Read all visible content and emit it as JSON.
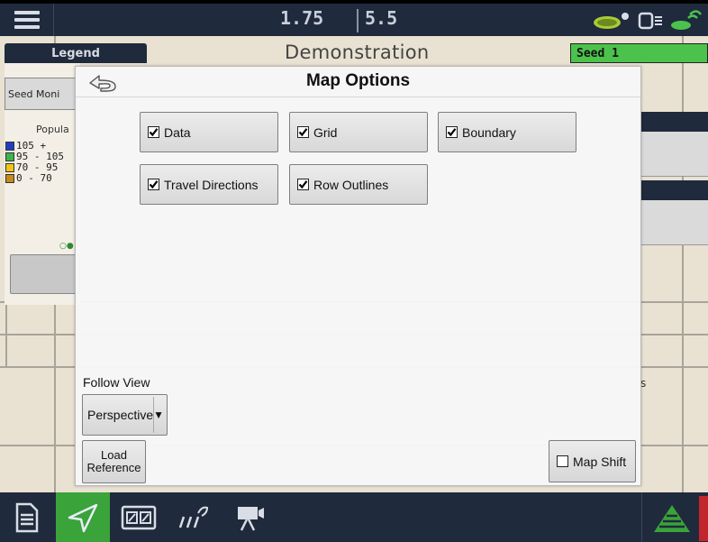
{
  "topbar": {
    "readout_left": "1.75",
    "readout_right": "5.5",
    "icons": [
      "menu-icon",
      "gps-antenna-icon",
      "isobus-icon",
      "rtk-signal-icon"
    ]
  },
  "map": {
    "title": "Demonstration",
    "legend_tab": "Legend",
    "seed_tab": "Seed 1",
    "seed_monitor_label": "Seed Moni",
    "population_label": "Popula",
    "legend_items": [
      {
        "label": "105 +",
        "color": "#1f3fbf"
      },
      {
        "label": "95 - 105",
        "color": "#3cb44b"
      },
      {
        "label": "70 - 95",
        "color": "#f2c318"
      },
      {
        "label": "0 - 70",
        "color": "#c58a1a"
      }
    ],
    "right_fragment": "s"
  },
  "dialog": {
    "title": "Map Options",
    "options": [
      {
        "label": "Data",
        "checked": true
      },
      {
        "label": "Grid",
        "checked": true
      },
      {
        "label": "Boundary",
        "checked": true
      },
      {
        "label": "Travel Directions",
        "checked": true
      },
      {
        "label": "Row Outlines",
        "checked": true
      }
    ],
    "follow_view_label": "Follow View",
    "follow_view_value": "Perspective",
    "load_reference_line1": "Load",
    "load_reference_line2": "Reference",
    "map_shift_label": "Map Shift",
    "map_shift_checked": false
  },
  "bottombar": {
    "buttons": [
      "home-page-icon",
      "guidance-icon",
      "split-screen-icon",
      "field-operations-icon",
      "video-icon"
    ],
    "active": "guidance-icon",
    "colors": {
      "bar": "#1f2a3c",
      "active": "#3aa33a",
      "alert": "#c0262b"
    }
  }
}
